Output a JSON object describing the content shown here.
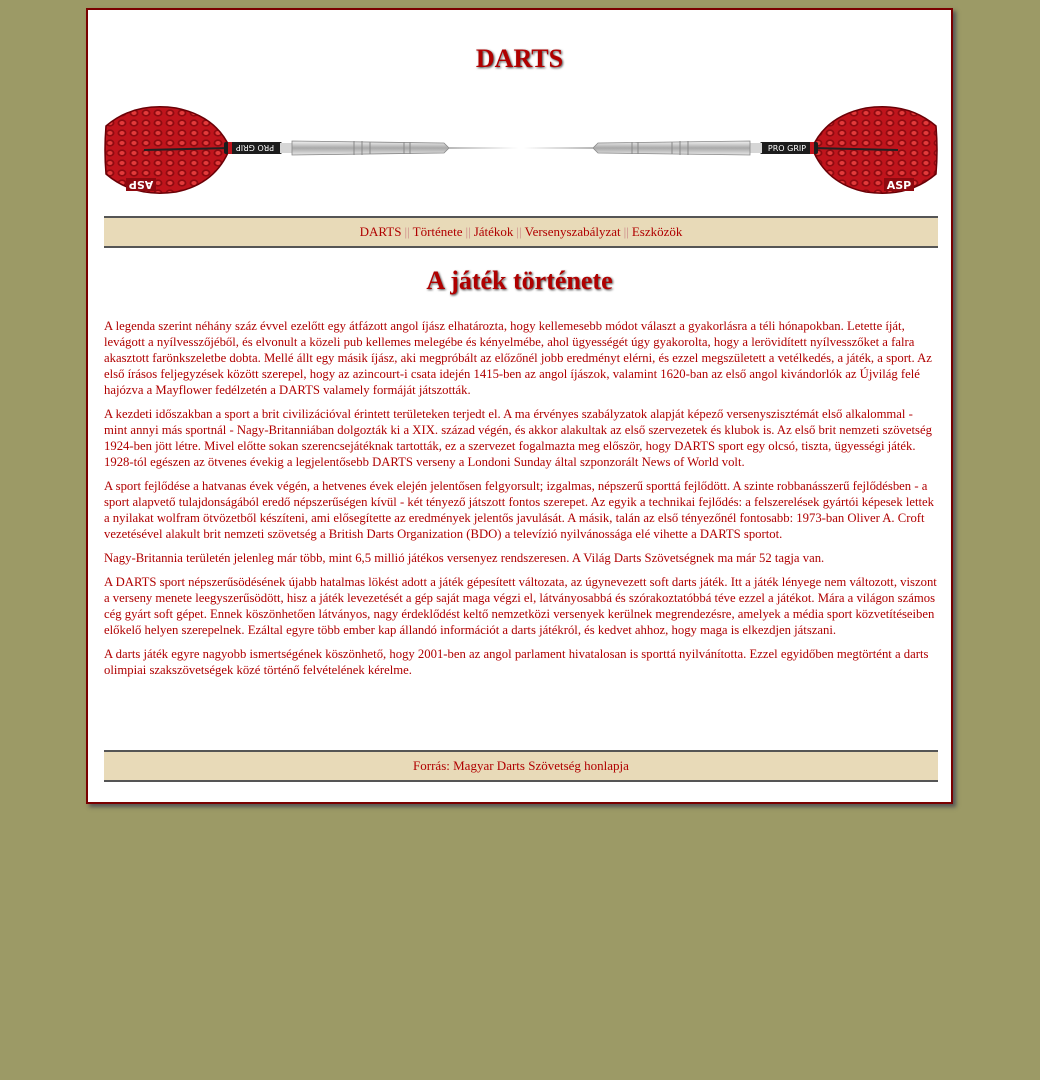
{
  "site_title": "DARTS",
  "nav": {
    "items": [
      "DARTS",
      "Története",
      "Játékok",
      "Versenyszabályzat",
      "Eszközök"
    ],
    "separator": "||"
  },
  "banner": {
    "left_dart_flight_logo": "ASP",
    "right_dart_flight_logo": "ASP",
    "left_grip_label": "PRO GRIP",
    "right_grip_label": "PRO GRIP"
  },
  "heading": "A játék története",
  "paragraphs": [
    "A legenda szerint néhány száz évvel ezelőtt egy átfázott angol íjász elhatározta, hogy kellemesebb módot választ a gyakorlásra a téli hónapokban. Letette íját, levágott a nyílvesszőjéből, és elvonult a közeli pub kellemes melegébe és kényelmébe, ahol ügyességét úgy gyakorolta, hogy a lerövidített nyílvesszőket a falra akasztott farönkszeletbe dobta. Mellé állt egy másik íjász, aki megpróbált az előzőnél jobb eredményt elérni, és ezzel megszületett a vetélkedés, a játék, a sport. Az első írásos feljegyzések között szerepel, hogy az azincourt-i csata idején 1415-ben az angol íjászok, valamint 1620-ban az első angol kivándorlók az Újvilág felé hajózva a Mayflower fedélzetén a DARTS valamely formáját játszották.",
    "A kezdeti időszakban a sport a brit civilizációval érintett területeken terjedt el. A ma érvényes szabályzatok alapját képező versenyszisztémát első alkalommal - mint annyi más sportnál - Nagy-Britanniában dolgozták ki a XIX. század végén, és akkor alakultak az első szervezetek és klubok is. Az első brit nemzeti szövetség 1924-ben jött létre. Mivel előtte sokan szerencsejátéknak tartották, ez a szervezet fogalmazta meg először, hogy DARTS sport egy olcsó, tiszta, ügyességi játék. 1928-tól egészen az ötvenes évekig a legjelentősebb DARTS verseny a Londoni Sunday által szponzorált News of World volt.",
    "A sport fejlődése a hatvanas évek végén, a hetvenes évek elején jelentősen felgyorsult; izgalmas, népszerű sporttá fejlődött. A szinte robbanásszerű fejlődésben - a sport alapvető tulajdonságából eredő népszerűségen kívül - két tényező játszott fontos szerepet. Az egyik a technikai fejlődés: a felszerelések gyártói képesek lettek a nyilakat wolfram ötvözetből készíteni, ami elősegítette az eredmények jelentős javulását. A másik, talán az első tényezőnél fontosabb: 1973-ban Oliver A. Croft vezetésével alakult brit nemzeti szövetség a British Darts Organization (BDO) a televízió nyilvánossága elé vihette a DARTS sportot.",
    "Nagy-Britannia területén jelenleg már több, mint 6,5 millió játékos versenyez rendszeresen. A Világ Darts Szövetségnek ma már 52 tagja van.",
    "A DARTS sport népszerűsödésének újabb hatalmas lökést adott a játék gépesített változata, az úgynevezett soft darts játék. Itt a játék lényege nem változott, viszont a verseny menete leegyszerűsödött, hisz a játék levezetését a gép saját maga végzi el, látványosabbá és szórakoztatóbbá téve ezzel a játékot. Mára a világon számos cég gyárt soft gépet. Ennek köszönhetően látványos, nagy érdeklődést keltő nemzetközi versenyek kerülnek megrendezésre, amelyek a média sport közvetítéseiben előkelő helyen szerepelnek. Ezáltal egyre több ember kap állandó információt a darts játékról, és kedvet ahhoz, hogy maga is elkezdjen játszani.",
    "A darts játék egyre nagyobb ismertségének köszönhető, hogy 2001-ben az angol parlament hivatalosan is sporttá nyilvánította. Ezzel egyidőben megtörtént a darts olimpiai szakszövetségek közé történő felvételének kérelme."
  ],
  "footer": "Forrás: Magyar Darts Szövetség honlapja",
  "colors": {
    "background": "#9c9a66",
    "text": "#b00000",
    "bar": "#e8dab8"
  }
}
